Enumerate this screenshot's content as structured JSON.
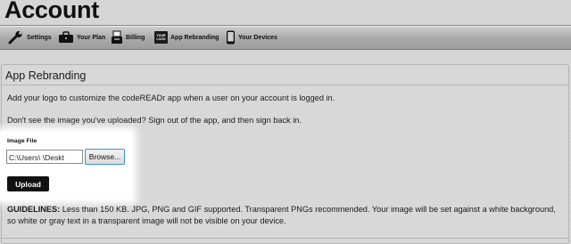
{
  "page": {
    "title": "Account"
  },
  "nav": {
    "items": [
      {
        "label": "Settings",
        "icon": "wrench-icon"
      },
      {
        "label": "Your Plan",
        "icon": "toolbox-icon"
      },
      {
        "label": "Billing",
        "icon": "register-icon"
      },
      {
        "label": "App Rebranding",
        "icon": "logo-badge-icon",
        "badge_text": "YOUR LOGO"
      },
      {
        "label": "Your Devices",
        "icon": "phone-icon"
      }
    ]
  },
  "panel": {
    "title": "App Rebranding",
    "intro": "Add your logo to customize the codeREADr app when a user on your account is logged in.",
    "hint": "Don't see the image you've uploaded? Sign out of the app, and then sign back in.",
    "image_file_label": "Image File",
    "file_path_value": "C:\\Users\\    \\Deskt",
    "browse_label": "Browse...",
    "upload_label": "Upload",
    "guidelines_heading": "GUIDELINES:",
    "guidelines_text": " Less than 150 KB. JPG, PNG and GIF supported. Transparent PNGs recommended. Your image will be set against a white background, so white or gray text in a transparent image will not be visible on your device."
  }
}
